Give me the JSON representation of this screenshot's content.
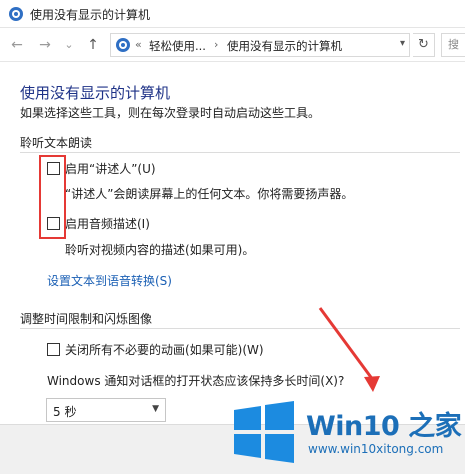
{
  "window": {
    "title": "使用没有显示的计算机"
  },
  "nav": {
    "back": "←",
    "forward": "→",
    "recent": "⌄",
    "up": "↑",
    "breadcrumbs": [
      "轻松使用...",
      "使用没有显示的计算机"
    ],
    "overflow": "«",
    "separator": "›",
    "dropdown": "▾",
    "refresh": "↻",
    "search_placeholder": "搜"
  },
  "page": {
    "title": "使用没有显示的计算机",
    "subtitle": "如果选择这些工具，则在每次登录时自动启动这些工具。"
  },
  "section_narrator": {
    "heading": "聆听文本朗读",
    "narrator_label": "启用“讲述人”(U)",
    "narrator_hint": "“讲述人”会朗读屏幕上的任何文本。你将需要扬声器。",
    "audio_desc_label": "启用音频描述(I)",
    "audio_desc_hint": "聆听对视频内容的描述(如果可用)。",
    "tts_link": "设置文本到语音转换(S)"
  },
  "section_time": {
    "heading": "调整时间限制和闪烁图像",
    "animations_label": "关闭所有不必要的动画(如果可能)(W)",
    "notify_question": "Windows 通知对话框的打开状态应该保持多长时间(X)?",
    "notify_selected": "5 秒"
  },
  "watermark": {
    "brand": "Win10 之家",
    "url": "www.win10xitong.com"
  },
  "colors": {
    "title_blue": "#1e3287",
    "link_blue": "#1a5fb4",
    "highlight_red": "#e53935",
    "brand_blue": "#1c6fb8"
  }
}
